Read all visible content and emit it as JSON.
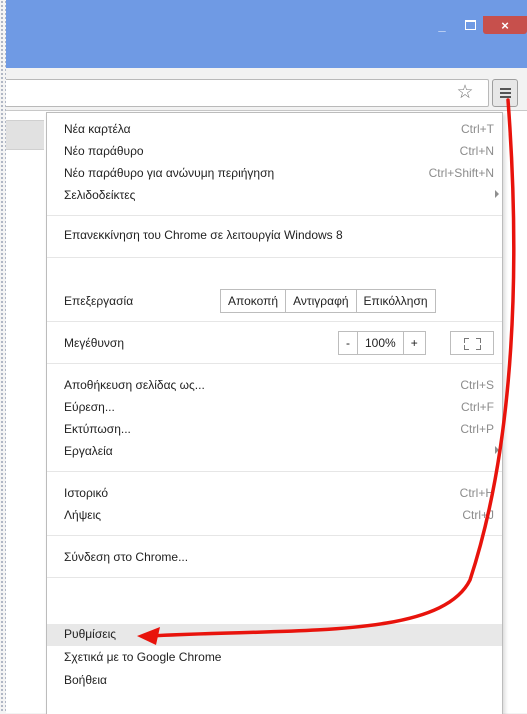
{
  "window": {
    "minimize_glyph": "_",
    "close_glyph": "×"
  },
  "toolbar": {
    "star_icon": "star-icon",
    "menu_icon": "hamburger-menu-icon"
  },
  "menu": {
    "new_tab": {
      "label": "Νέα καρτέλα",
      "shortcut": "Ctrl+T"
    },
    "new_window": {
      "label": "Νέο παράθυρο",
      "shortcut": "Ctrl+N"
    },
    "incognito": {
      "label": "Νέο παράθυρο για ανώνυμη περιήγηση",
      "shortcut": "Ctrl+Shift+N"
    },
    "bookmarks": {
      "label": "Σελιδοδείκτες"
    },
    "relaunch": {
      "label": "Επανεκκίνηση του Chrome σε λειτουργία Windows 8"
    },
    "edit": {
      "label": "Επεξεργασία",
      "cut": "Αποκοπή",
      "copy": "Αντιγραφή",
      "paste": "Επικόλληση"
    },
    "zoom": {
      "label": "Μεγέθυνση",
      "minus": "-",
      "value": "100%",
      "plus": "+"
    },
    "save_as": {
      "label": "Αποθήκευση σελίδας ως...",
      "shortcut": "Ctrl+S"
    },
    "find": {
      "label": "Εύρεση...",
      "shortcut": "Ctrl+F"
    },
    "print": {
      "label": "Εκτύπωση...",
      "shortcut": "Ctrl+P"
    },
    "tools": {
      "label": "Εργαλεία"
    },
    "history": {
      "label": "Ιστορικό",
      "shortcut": "Ctrl+H"
    },
    "downloads": {
      "label": "Λήψεις",
      "shortcut": "Ctrl+J"
    },
    "signin": {
      "label": "Σύνδεση στο Chrome..."
    },
    "settings": {
      "label": "Ρυθμίσεις"
    },
    "about": {
      "label": "Σχετικά με το Google Chrome"
    },
    "help": {
      "label": "Βοήθεια"
    }
  },
  "colors": {
    "titlebar": "#6f9ae4",
    "close": "#c7504c",
    "annotation_arrow": "#e8130c"
  }
}
